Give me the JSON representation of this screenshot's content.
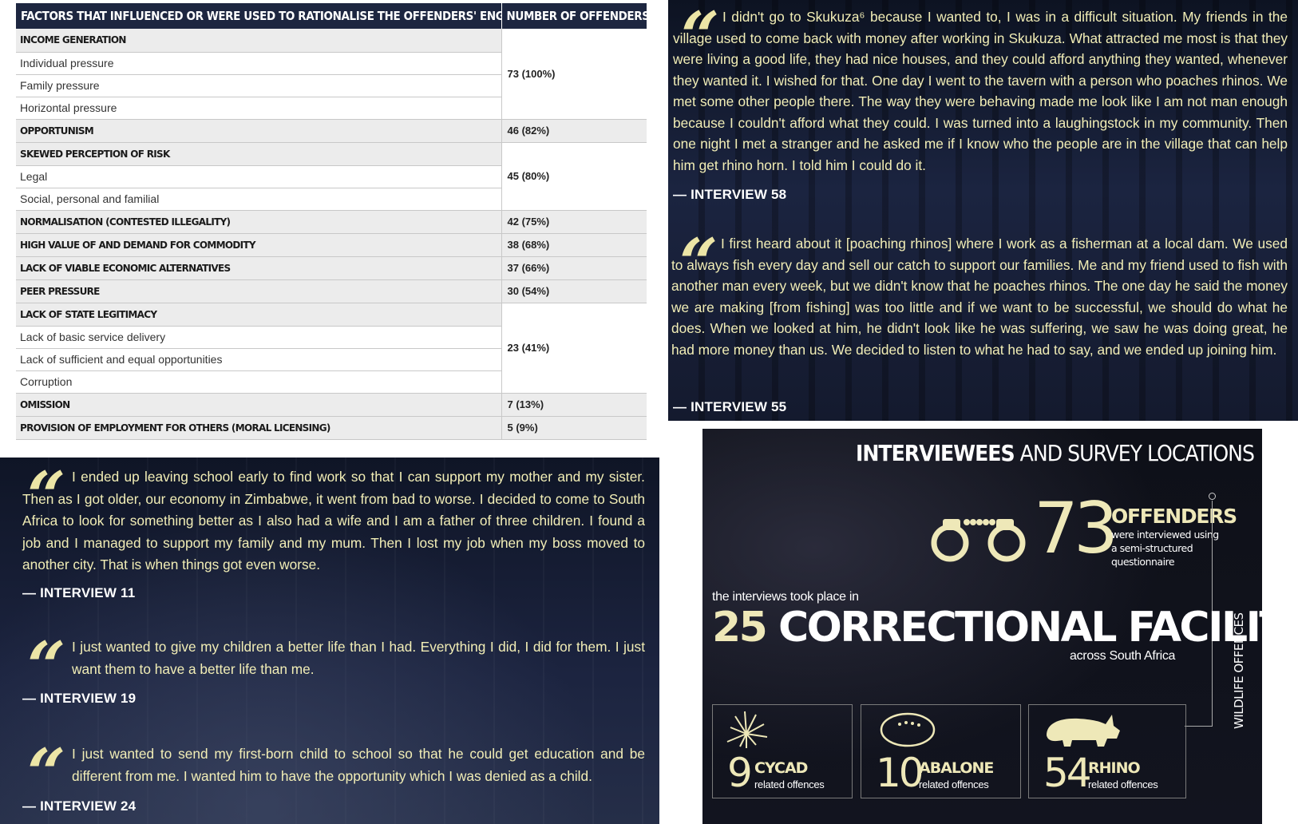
{
  "table": {
    "header_factor": "FACTORS THAT INFLUENCED OR WERE USED TO RATIONALISE THE OFFENDERS' ENGAGEMENT IN IWT",
    "header_count": "NUMBER OF OFFENDERS (%)",
    "groups": [
      {
        "category": "INCOME GENERATION",
        "subs": [
          "Individual pressure",
          "Family pressure",
          "Horizontal pressure"
        ],
        "value": "73 (100%)"
      },
      {
        "category": "OPPORTUNISM",
        "subs": [],
        "value": "46 (82%)"
      },
      {
        "category": "SKEWED PERCEPTION OF RISK",
        "subs": [
          "Legal",
          "Social, personal and familial"
        ],
        "value": "45 (80%)"
      },
      {
        "category": "NORMALISATION (CONTESTED ILLEGALITY)",
        "subs": [],
        "value": "42 (75%)"
      },
      {
        "category": "HIGH VALUE OF AND DEMAND FOR COMMODITY",
        "subs": [],
        "value": "38 (68%)"
      },
      {
        "category": "LACK OF VIABLE ECONOMIC ALTERNATIVES",
        "subs": [],
        "value": "37 (66%)"
      },
      {
        "category": "PEER PRESSURE",
        "subs": [],
        "value": "30 (54%)"
      },
      {
        "category": "LACK OF STATE LEGITIMACY",
        "subs": [
          "Lack of basic service delivery",
          "Lack of sufficient and equal opportunities",
          "Corruption"
        ],
        "value": "23 (41%)"
      },
      {
        "category": "OMISSION",
        "subs": [],
        "value": "7 (13%)"
      },
      {
        "category": "PROVISION OF EMPLOYMENT FOR OTHERS (MORAL LICENSING)",
        "subs": [],
        "value": "5 (9%)"
      }
    ]
  },
  "quotes_right": [
    {
      "mark": "“",
      "text": "I didn't go to Skukuza⁶ because I wanted to, I was in a difficult situation. My friends in the village used to come back with money after working in Skukuza. What attracted me most is that they were living a good life, they had nice houses, and they could afford anything they wanted, whenever they wanted it. I wished for that. One day I went to the tavern with a person who poaches rhinos. We met some other people there. The way they were behaving made me look like I am not man enough because I couldn't afford what they could. I was turned into a laughingstock in my community. Then one night I met a stranger and he asked me if I know who the people are in the village that can help him get rhino horn. I told him I could do it.",
      "source": "— INTERVIEW 58"
    },
    {
      "mark": "“",
      "text": "I first heard about it [poaching rhinos] where I work as a fisherman at a local dam. We used to always fish every day and sell our catch to support our families. Me and my friend used to fish with another man every week, but we didn't know that he poaches rhinos. The one day he said the money we are making [from fishing] was too little and if we want to be successful, we should do what he does. When we looked at him, he didn't look like he was suffering, we saw he was doing great, he had more money than us. We decided to listen to what he had to say, and we ended up joining him.",
      "source": "— INTERVIEW 55"
    }
  ],
  "quotes_left": [
    {
      "mark": "“",
      "text": "I ended up leaving school early to find work so that I can support my mother and my sister. Then as I got older, our economy in Zimbabwe, it went from bad to worse. I decided to come to South Africa to look for something better as I also had a wife and I am a father of three children. I found a job and I managed to support my family and my mum. Then I lost my job when my boss moved to another city. That is when things got even worse.",
      "source": "— INTERVIEW 11"
    },
    {
      "mark": "“",
      "text": "I just wanted to give my children a better life than I had. Everything I did, I did for them. I just want them to have a better life than me.",
      "source": "— INTERVIEW 19"
    },
    {
      "mark": "“",
      "text": "I just wanted to send my first-born child to school so that he could get education and be different from me. I wanted him to have the opportunity which I was denied as a child.",
      "source": "— INTERVIEW 24"
    }
  ],
  "infographic": {
    "title_bold": "INTERVIEWEES",
    "title_rest": " AND SURVEY LOCATIONS",
    "offenders_count": "73",
    "offenders_label": "OFFENDERS",
    "offenders_desc": "were interviewed using a semi-structured questionnaire",
    "took_place": "the interviews took place in",
    "facilities_count": "25",
    "facilities_label": " CORRECTIONAL FACILITIES",
    "across": "across South Africa",
    "side_label": "WILDLIFE OFFENCES",
    "offences": [
      {
        "count": "9",
        "name": "CYCAD",
        "sub": "related offences",
        "icon": "cycad-icon"
      },
      {
        "count": "10",
        "name": "ABALONE",
        "sub": "related offences",
        "icon": "abalone-icon"
      },
      {
        "count": "54",
        "name": "RHINO",
        "sub": "related offences",
        "icon": "rhino-icon"
      }
    ],
    "colors": {
      "accent": "#eee8b8",
      "quote_text": "#f2eeb6",
      "table_header": "#1d2640"
    }
  }
}
